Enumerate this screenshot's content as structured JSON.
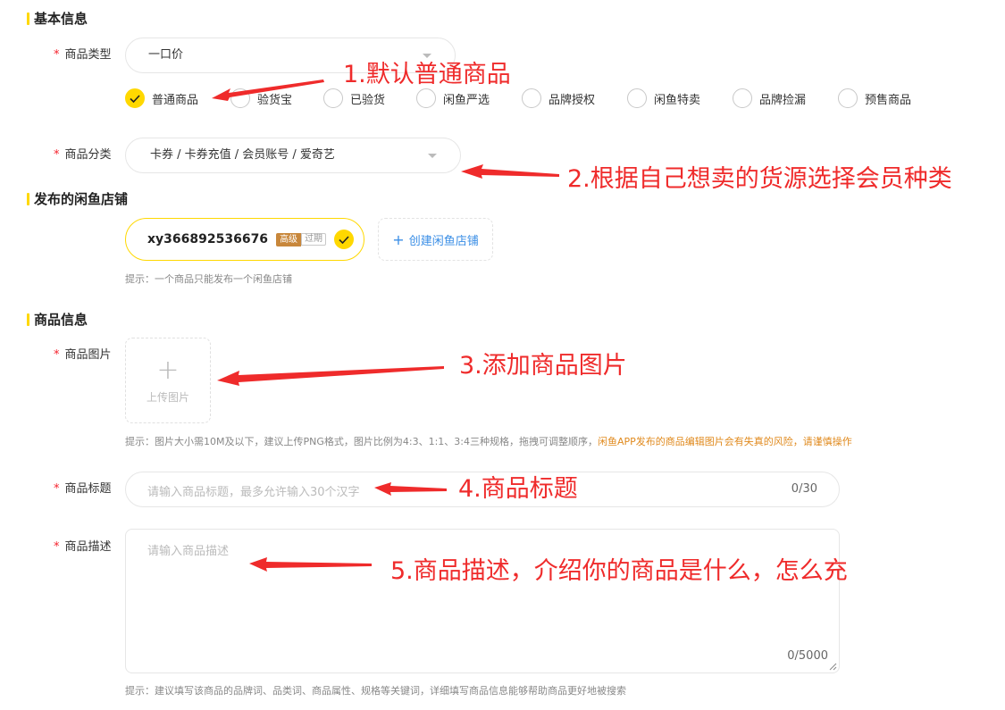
{
  "colors": {
    "accent": "#ffd800",
    "required": "#f5222d",
    "annotation": "#ef2b2b",
    "link": "#3a8ee6",
    "warning": "#e08a1e"
  },
  "basic_info": {
    "title": "基本信息",
    "product_type": {
      "label": "商品类型",
      "required_mark": "*",
      "selected_value": "一口价",
      "options": [
        "普通商品",
        "验货宝",
        "已验货",
        "闲鱼严选",
        "品牌授权",
        "闲鱼特卖",
        "品牌捡漏",
        "预售商品"
      ],
      "checked_option": "普通商品"
    },
    "category": {
      "label": "商品分类",
      "required_mark": "*",
      "selected_value": "卡券 / 卡券充值 / 会员账号 / 爱奇艺"
    }
  },
  "store": {
    "title": "发布的闲鱼店铺",
    "store_name": "xy366892536676",
    "badge_level": "高级",
    "badge_status": "过期",
    "create_button": "创建闲鱼店铺",
    "hint": "提示：一个商品只能发布一个闲鱼店铺"
  },
  "product_info": {
    "title": "商品信息",
    "image": {
      "label": "商品图片",
      "required_mark": "*",
      "upload_text": "上传图片",
      "hint": "提示：图片大小需10M及以下，建议上传PNG格式，图片比例为4:3、1:1、3:4三种规格，拖拽可调整顺序，",
      "hint_warning": "闲鱼APP发布的商品编辑图片会有失真的风险，请谨慎操作"
    },
    "product_title": {
      "label": "商品标题",
      "required_mark": "*",
      "placeholder": "请输入商品标题，最多允许输入30个汉字",
      "counter": "0/30"
    },
    "description": {
      "label": "商品描述",
      "required_mark": "*",
      "placeholder": "请输入商品描述",
      "counter": "0/5000",
      "hint": "提示：建议填写该商品的品牌词、品类词、商品属性、规格等关键词，详细填写商品信息能够帮助商品更好地被搜索"
    }
  },
  "annotations": {
    "a1": "1.默认普通商品",
    "a2": "2.根据自己想卖的货源选择会员种类",
    "a3": "3.添加商品图片",
    "a4": "4.商品标题",
    "a5": "5.商品描述，介绍你的商品是什么，怎么充"
  }
}
